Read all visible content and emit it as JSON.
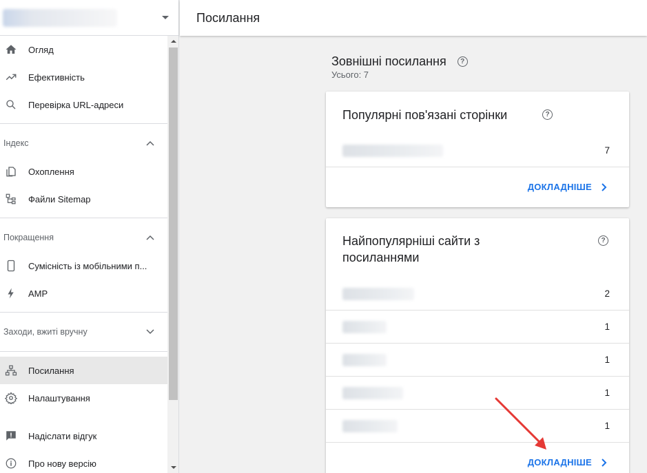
{
  "header": {
    "title": "Посилання"
  },
  "sidebar": {
    "items_top": [
      {
        "label": "Огляд",
        "icon": "home-icon"
      },
      {
        "label": "Ефективність",
        "icon": "trending-up-icon"
      },
      {
        "label": "Перевірка URL-адреси",
        "icon": "search-icon"
      }
    ],
    "sections": {
      "index": {
        "label": "Індекс",
        "expanded": true
      },
      "enhancements": {
        "label": "Покращення",
        "expanded": true
      },
      "manual": {
        "label": "Заходи, вжиті вручну",
        "expanded": false
      }
    },
    "index_items": [
      {
        "label": "Охоплення",
        "icon": "coverage-icon"
      },
      {
        "label": "Файли Sitemap",
        "icon": "sitemap-icon"
      }
    ],
    "enh_items": [
      {
        "label": "Сумісність із мобільними п...",
        "icon": "mobile-icon"
      },
      {
        "label": "AMP",
        "icon": "amp-bolt-icon"
      }
    ],
    "bottom_items": [
      {
        "label": "Посилання",
        "icon": "links-icon",
        "active": true
      },
      {
        "label": "Налаштування",
        "icon": "settings-icon"
      },
      {
        "label": "Надіслати відгук",
        "icon": "feedback-icon"
      },
      {
        "label": "Про нову версію",
        "icon": "info-icon"
      }
    ]
  },
  "main": {
    "section_title": "Зовнішні посилання",
    "total": "Усього: 7",
    "card1": {
      "title": "Популярні пов'язані сторінки",
      "rows": [
        {
          "value": "7"
        }
      ],
      "more": "ДОКЛАДНІШЕ"
    },
    "card2": {
      "title_line1": "Найпопулярніші сайти з",
      "title_line2": "посиланнями",
      "rows": [
        {
          "value": "2"
        },
        {
          "value": "1"
        },
        {
          "value": "1"
        },
        {
          "value": "1"
        },
        {
          "value": "1"
        }
      ],
      "more": "ДОКЛАДНІШЕ"
    }
  },
  "colors": {
    "accent": "#1a73e8",
    "annotation_arrow": "#e53935"
  }
}
